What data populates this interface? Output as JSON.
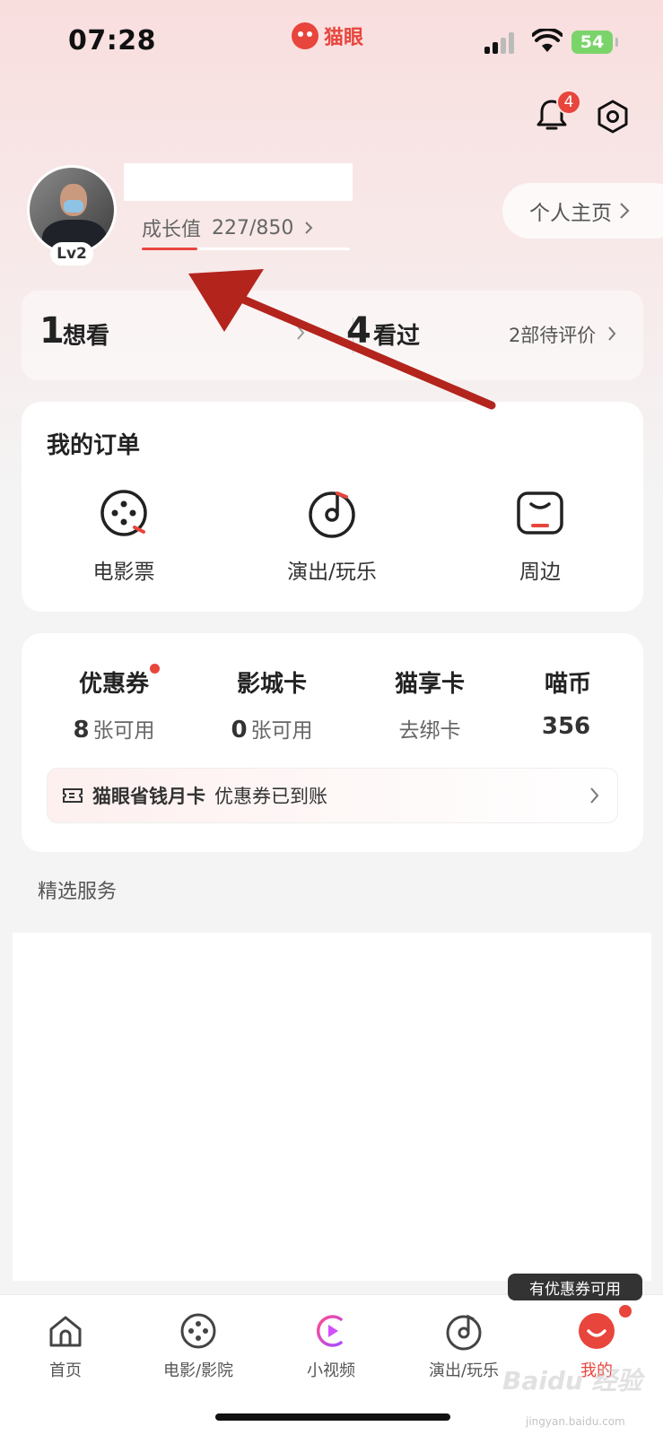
{
  "status_bar": {
    "time": "07:28",
    "app_name": "猫眼",
    "battery": "54"
  },
  "header": {
    "notification_count": "4"
  },
  "profile": {
    "level": "Lv2",
    "growth_label": "成长值",
    "growth_value": "227/850",
    "growth_progress": 0.267,
    "profile_button": "个人主页"
  },
  "stats": {
    "want_count": "1",
    "want_label": "想看",
    "seen_count": "4",
    "seen_label": "看过",
    "pending_reviews": "2部待评价"
  },
  "orders": {
    "title": "我的订单",
    "items": [
      {
        "label": "电影票",
        "icon": "film-reel-icon"
      },
      {
        "label": "演出/玩乐",
        "icon": "music-disc-icon"
      },
      {
        "label": "周边",
        "icon": "box-icon"
      }
    ]
  },
  "wallet": {
    "coupon_title": "优惠券",
    "coupon_count": "8",
    "coupon_unit": "张可用",
    "cinema_card_title": "影城卡",
    "cinema_card_count": "0",
    "cinema_card_unit": "张可用",
    "maoxiang_title": "猫享卡",
    "maoxiang_sub": "去绑卡",
    "coin_title": "喵币",
    "coin_value": "356",
    "promo_title": "猫眼省钱月卡",
    "promo_text": "优惠券已到账"
  },
  "services": {
    "title": "精选服务",
    "coin_tip": "有优惠券可用"
  },
  "tabbar": {
    "items": [
      {
        "label": "首页",
        "icon": "home-icon"
      },
      {
        "label": "电影/影院",
        "icon": "film-reel-icon"
      },
      {
        "label": "小视频",
        "icon": "video-play-icon"
      },
      {
        "label": "演出/玩乐",
        "icon": "music-disc-icon"
      },
      {
        "label": "我的",
        "icon": "user-icon"
      }
    ]
  },
  "watermark": {
    "text": "Baidu 经验",
    "url": "jingyan.baidu.com"
  },
  "colors": {
    "accent": "#e8453c",
    "arrow": "#b3241d"
  }
}
